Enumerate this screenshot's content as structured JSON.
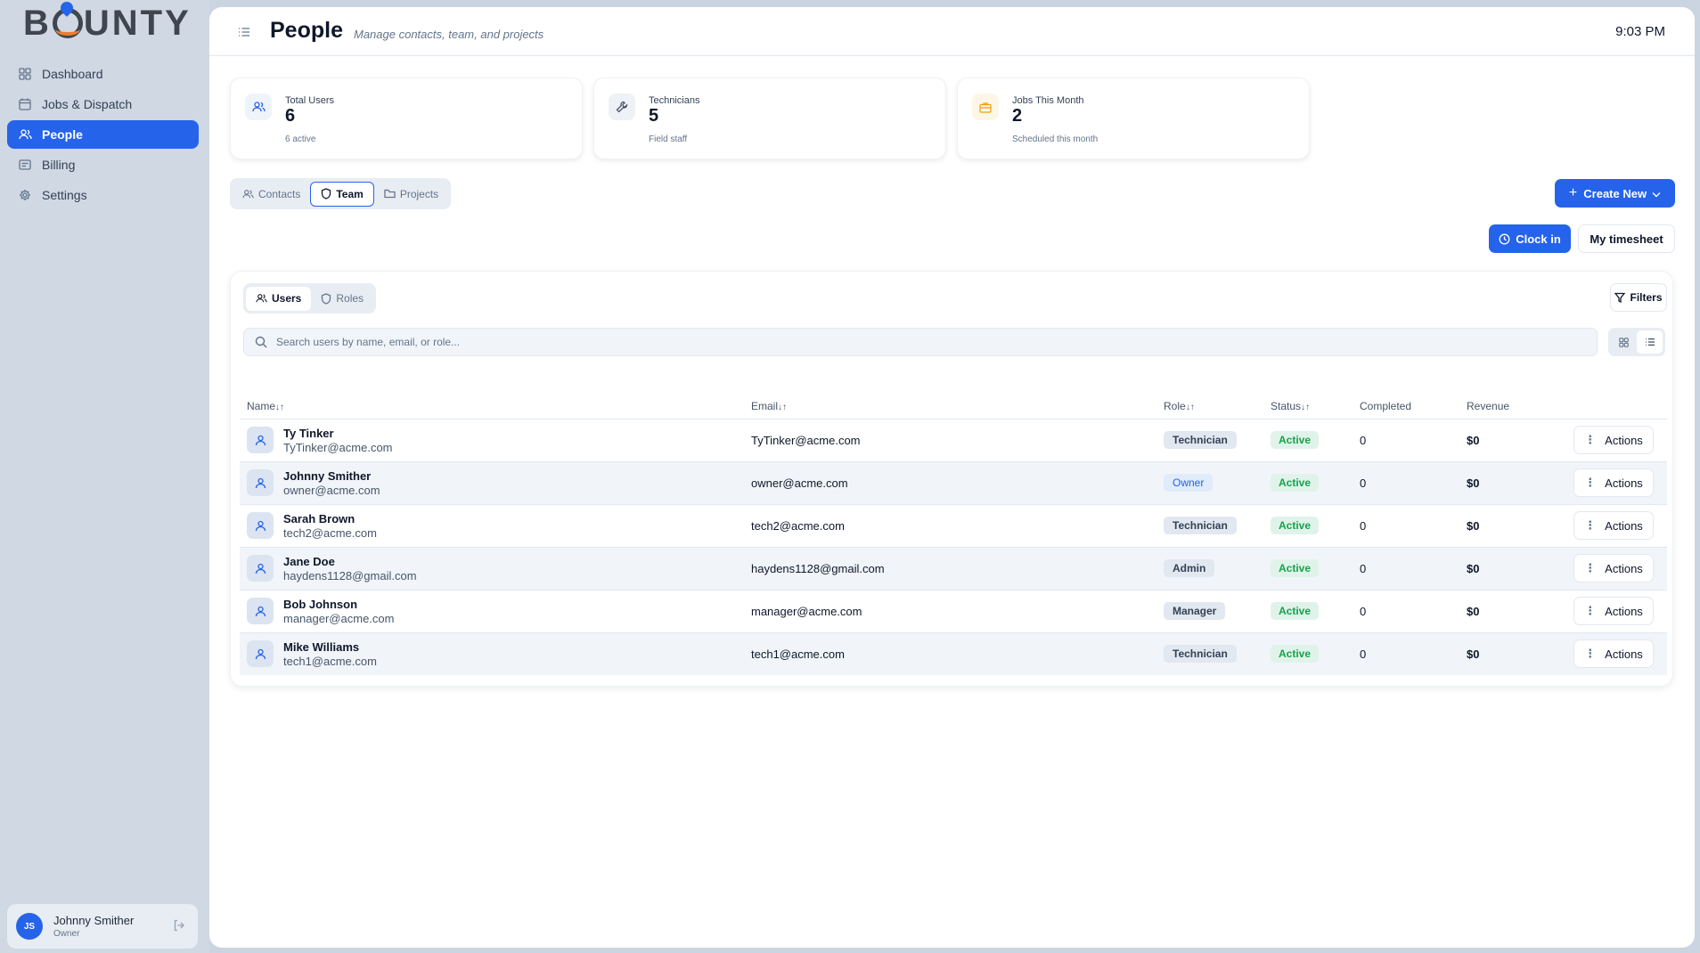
{
  "app": {
    "logo_text": "BOUNTY",
    "logo_left": "B",
    "logo_right": "UNTY"
  },
  "sidebar": {
    "items": [
      {
        "label": "Dashboard",
        "icon": "grid-icon",
        "active": false
      },
      {
        "label": "Jobs & Dispatch",
        "icon": "calendar-icon",
        "active": false
      },
      {
        "label": "People",
        "icon": "users-icon",
        "active": true
      },
      {
        "label": "Billing",
        "icon": "receipt-icon",
        "active": false
      },
      {
        "label": "Settings",
        "icon": "gear-icon",
        "active": false
      }
    ],
    "user": {
      "initials": "JS",
      "name": "Johnny Smither",
      "role": "Owner"
    }
  },
  "header": {
    "title": "People",
    "subtitle": "Manage contacts, team, and projects",
    "time": "9:03 PM"
  },
  "stats": [
    {
      "label": "Total Users",
      "value": "6",
      "sub": "6 active",
      "icon": "users-icon",
      "color": "#2563eb"
    },
    {
      "label": "Technicians",
      "value": "5",
      "sub": "Field staff",
      "icon": "wrench-icon",
      "color": "#475569"
    },
    {
      "label": "Jobs This Month",
      "value": "2",
      "sub": "Scheduled this month",
      "icon": "briefcase-icon",
      "color": "#f59e0b"
    }
  ],
  "tabs": {
    "contacts": "Contacts",
    "team": "Team",
    "projects": "Projects",
    "active": "Team"
  },
  "actions": {
    "create_new": "Create New",
    "clock_in": "Clock in",
    "timesheet": "My timesheet"
  },
  "subtabs": {
    "users": "Users",
    "roles": "Roles",
    "active": "Users"
  },
  "filters_label": "Filters",
  "search": {
    "placeholder": "Search users by name, email, or role...",
    "value": ""
  },
  "view_mode": "list",
  "table": {
    "headers": {
      "name": "Name",
      "email": "Email",
      "role": "Role",
      "status": "Status",
      "completed": "Completed",
      "revenue": "Revenue"
    },
    "sort_glyph": "↓↑",
    "action_label": "Actions",
    "rows": [
      {
        "name": "Ty Tinker",
        "sub_email": "TyTinker@acme.com",
        "email": "TyTinker@acme.com",
        "role": "Technician",
        "status": "Active",
        "completed": "0",
        "revenue": "$0"
      },
      {
        "name": "Johnny Smither",
        "sub_email": "owner@acme.com",
        "email": "owner@acme.com",
        "role": "Owner",
        "status": "Active",
        "completed": "0",
        "revenue": "$0"
      },
      {
        "name": "Sarah Brown",
        "sub_email": "tech2@acme.com",
        "email": "tech2@acme.com",
        "role": "Technician",
        "status": "Active",
        "completed": "0",
        "revenue": "$0"
      },
      {
        "name": "Jane Doe",
        "sub_email": "haydens1128@gmail.com",
        "email": "haydens1128@gmail.com",
        "role": "Admin",
        "status": "Active",
        "completed": "0",
        "revenue": "$0"
      },
      {
        "name": "Bob Johnson",
        "sub_email": "manager@acme.com",
        "email": "manager@acme.com",
        "role": "Manager",
        "status": "Active",
        "completed": "0",
        "revenue": "$0"
      },
      {
        "name": "Mike Williams",
        "sub_email": "tech1@acme.com",
        "email": "tech1@acme.com",
        "role": "Technician",
        "status": "Active",
        "completed": "0",
        "revenue": "$0"
      }
    ]
  },
  "colors": {
    "accent": "#2563eb",
    "sidebar_bg": "#cfd8e3",
    "status_active": "#16a34a"
  }
}
